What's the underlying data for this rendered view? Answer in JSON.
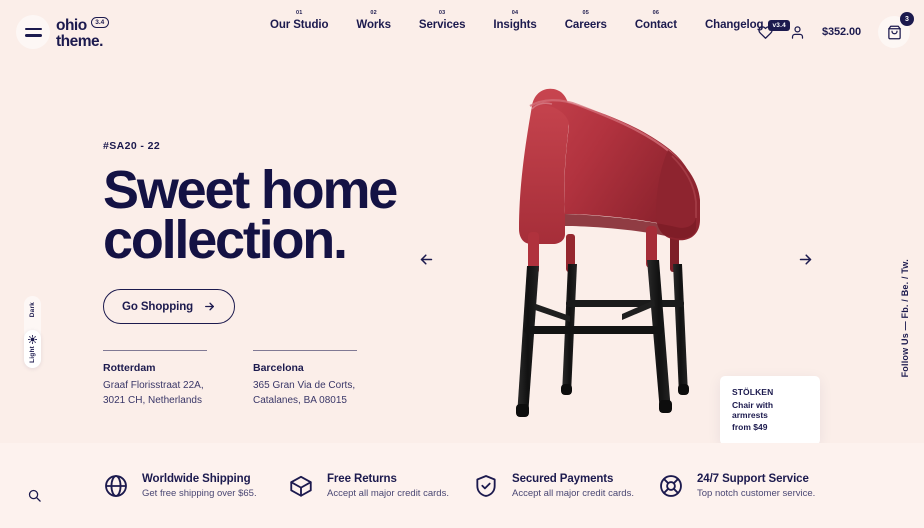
{
  "colors": {
    "background": "#FBEEE9",
    "features_background": "#FDF2EE",
    "ink": "#1C1A4E",
    "chair_shell": "#B33541",
    "chair_legs": "#1A1A1A",
    "card_background": "#FFFFFF"
  },
  "header": {
    "menu_icon": "hamburger-icon",
    "logo": {
      "line1": "ohio",
      "line2": "theme.",
      "badge": "3.4"
    },
    "nav": [
      {
        "num": "01",
        "label": "Our Studio"
      },
      {
        "num": "02",
        "label": "Works"
      },
      {
        "num": "03",
        "label": "Services"
      },
      {
        "num": "04",
        "label": "Insights"
      },
      {
        "num": "05",
        "label": "Careers"
      },
      {
        "num": "06",
        "label": "Contact"
      }
    ],
    "changelog": {
      "label": "Changelog",
      "version": "v3.4"
    },
    "actions": {
      "wishlist_icon": "heart-icon",
      "account_icon": "user-icon",
      "cart_total": "$352.00",
      "cart_icon": "shopping-bag-icon",
      "cart_count": "3"
    }
  },
  "hero": {
    "sku": "#SA20 - 22",
    "headline_line1": "Sweet home",
    "headline_line2": "collection.",
    "cta": {
      "label": "Go Shopping",
      "icon": "arrow-right-icon"
    },
    "addresses": [
      {
        "city": "Rotterdam",
        "line1": "Graaf Florisstraat 22A,",
        "line2": "3021 CH, Netherlands"
      },
      {
        "city": "Barcelona",
        "line1": "365 Gran Via de Corts,",
        "line2": "Catalanes, BA 08015"
      }
    ],
    "carousel": {
      "prev_icon": "arrow-left-icon",
      "next_icon": "arrow-right-icon"
    },
    "product_card": {
      "name": "STÖLKEN",
      "description": "Chair with armrests",
      "price": "from $49"
    }
  },
  "theme_toggle": {
    "dark_label": "Dark",
    "light_label": "Light",
    "sun_icon": "sun-icon",
    "active": "Light"
  },
  "social": {
    "label": "Follow Us — Fb. / Be. / Tw."
  },
  "features": [
    {
      "icon": "globe-icon",
      "title": "Worldwide Shipping",
      "subtitle": "Get free shipping over $65."
    },
    {
      "icon": "box-icon",
      "title": "Free Returns",
      "subtitle": "Accept all major credit cards."
    },
    {
      "icon": "shield-check-icon",
      "title": "Secured Payments",
      "subtitle": "Accept all major credit cards."
    },
    {
      "icon": "lifebuoy-icon",
      "title": "24/7 Support Service",
      "subtitle": "Top notch customer service."
    }
  ],
  "search": {
    "icon": "search-icon"
  }
}
